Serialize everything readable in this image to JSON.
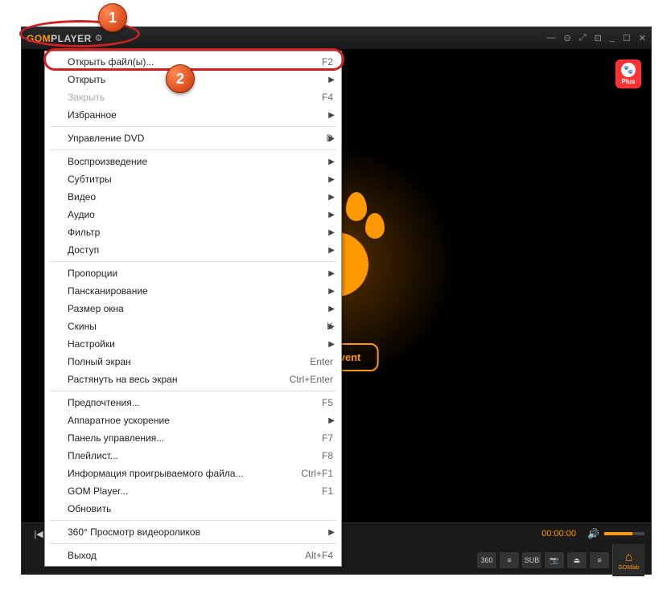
{
  "app": {
    "logo_gom": "GOM",
    "logo_player": "PLAYER",
    "plus_label": "Plus",
    "event_button": "cial Event",
    "time": "00:00:00",
    "gomlab": "GOMlab"
  },
  "callouts": {
    "badge1": "1",
    "badge2": "2"
  },
  "menu": [
    {
      "type": "item",
      "label": "Открыть файл(ы)...",
      "shortcut": "F2",
      "submenu": false,
      "disabled": false
    },
    {
      "type": "item",
      "label": "Открыть",
      "shortcut": "",
      "submenu": true,
      "disabled": false
    },
    {
      "type": "item",
      "label": "Закрыть",
      "shortcut": "F4",
      "submenu": false,
      "disabled": true
    },
    {
      "type": "item",
      "label": "Избранное",
      "shortcut": "",
      "submenu": true,
      "disabled": false
    },
    {
      "type": "sep"
    },
    {
      "type": "item",
      "label": "Управление DVD",
      "shortcut": "D",
      "submenu": true,
      "disabled": false
    },
    {
      "type": "sep"
    },
    {
      "type": "item",
      "label": "Воспроизведение",
      "shortcut": "",
      "submenu": true,
      "disabled": false
    },
    {
      "type": "item",
      "label": "Субтитры",
      "shortcut": "",
      "submenu": true,
      "disabled": false
    },
    {
      "type": "item",
      "label": "Видео",
      "shortcut": "",
      "submenu": true,
      "disabled": false
    },
    {
      "type": "item",
      "label": "Аудио",
      "shortcut": "",
      "submenu": true,
      "disabled": false
    },
    {
      "type": "item",
      "label": "Фильтр",
      "shortcut": "",
      "submenu": true,
      "disabled": false
    },
    {
      "type": "item",
      "label": "Доступ",
      "shortcut": "",
      "submenu": true,
      "disabled": false
    },
    {
      "type": "sep"
    },
    {
      "type": "item",
      "label": "Пропорции",
      "shortcut": "",
      "submenu": true,
      "disabled": false
    },
    {
      "type": "item",
      "label": "Пансканирование",
      "shortcut": "",
      "submenu": true,
      "disabled": false
    },
    {
      "type": "item",
      "label": "Размер окна",
      "shortcut": "",
      "submenu": true,
      "disabled": false
    },
    {
      "type": "item",
      "label": "Скины",
      "shortcut": "K",
      "submenu": true,
      "disabled": false
    },
    {
      "type": "item",
      "label": "Настройки",
      "shortcut": "",
      "submenu": true,
      "disabled": false
    },
    {
      "type": "item",
      "label": "Полный экран",
      "shortcut": "Enter",
      "submenu": false,
      "disabled": false
    },
    {
      "type": "item",
      "label": "Растянуть на весь экран",
      "shortcut": "Ctrl+Enter",
      "submenu": false,
      "disabled": false
    },
    {
      "type": "sep"
    },
    {
      "type": "item",
      "label": "Предпочтения...",
      "shortcut": "F5",
      "submenu": false,
      "disabled": false
    },
    {
      "type": "item",
      "label": "Аппаратное ускорение",
      "shortcut": "",
      "submenu": true,
      "disabled": false
    },
    {
      "type": "item",
      "label": "Панель управления...",
      "shortcut": "F7",
      "submenu": false,
      "disabled": false
    },
    {
      "type": "item",
      "label": "Плейлист...",
      "shortcut": "F8",
      "submenu": false,
      "disabled": false
    },
    {
      "type": "item",
      "label": "Информация проигрываемого файла...",
      "shortcut": "Ctrl+F1",
      "submenu": false,
      "disabled": false
    },
    {
      "type": "item",
      "label": "GOM Player...",
      "shortcut": "F1",
      "submenu": false,
      "disabled": false
    },
    {
      "type": "item",
      "label": "Обновить",
      "shortcut": "",
      "submenu": false,
      "disabled": false
    },
    {
      "type": "sep"
    },
    {
      "type": "item",
      "label": "360° Просмотр видеороликов",
      "shortcut": "",
      "submenu": true,
      "disabled": false
    },
    {
      "type": "sep"
    },
    {
      "type": "item",
      "label": "Выход",
      "shortcut": "Alt+F4",
      "submenu": false,
      "disabled": false
    }
  ],
  "toolbar": {
    "btn_360": "360",
    "btn_eq": "≡",
    "btn_sub": "SUB",
    "btn_cam": "📷"
  }
}
